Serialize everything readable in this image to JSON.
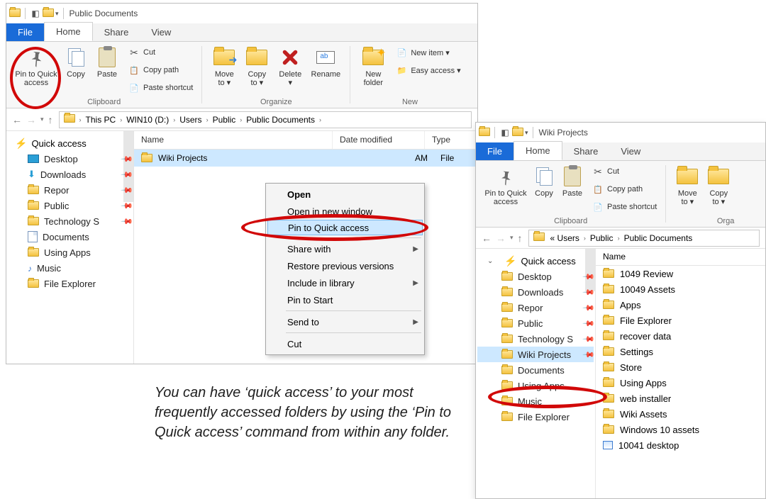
{
  "win1": {
    "title": "Public Documents",
    "tabs": {
      "file": "File",
      "home": "Home",
      "share": "Share",
      "view": "View"
    },
    "ribbon": {
      "pin": "Pin to Quick\naccess",
      "copy": "Copy",
      "paste": "Paste",
      "cut": "Cut",
      "copypath": "Copy path",
      "pasteshortcut": "Paste shortcut",
      "moveto": "Move\nto ▾",
      "copyto": "Copy\nto ▾",
      "delete": "Delete\n▾",
      "rename": "Rename",
      "newfolder": "New\nfolder",
      "newitem": "New item ▾",
      "easyaccess": "Easy access ▾",
      "g_clipboard": "Clipboard",
      "g_organize": "Organize",
      "g_new": "New"
    },
    "breadcrumb": [
      "This PC",
      "WIN10 (D:)",
      "Users",
      "Public",
      "Public Documents"
    ],
    "quickaccess_header": "Quick access",
    "tree": [
      {
        "label": "Desktop",
        "pin": true,
        "ico": "desktop"
      },
      {
        "label": "Downloads",
        "pin": true,
        "ico": "downloads"
      },
      {
        "label": "Repor",
        "pin": true,
        "ico": "folder"
      },
      {
        "label": "Public",
        "pin": true,
        "ico": "folder"
      },
      {
        "label": "Technology S",
        "pin": true,
        "ico": "folder"
      },
      {
        "label": "Documents",
        "pin": false,
        "ico": "doc"
      },
      {
        "label": "Using Apps",
        "pin": false,
        "ico": "folder"
      },
      {
        "label": "Music",
        "pin": false,
        "ico": "music"
      },
      {
        "label": "File Explorer",
        "pin": false,
        "ico": "folder"
      }
    ],
    "columns": {
      "name": "Name",
      "date": "Date modified",
      "type": "Type"
    },
    "row": {
      "name": "Wiki Projects",
      "date": "AM",
      "type": "File"
    },
    "ctx": {
      "open": "Open",
      "opennew": "Open in new window",
      "pin": "Pin to Quick access",
      "sharewith": "Share with",
      "restore": "Restore previous versions",
      "include": "Include in library",
      "pinstart": "Pin to Start",
      "sendto": "Send to",
      "cut": "Cut"
    }
  },
  "win2": {
    "title": "Wiki Projects",
    "tabs": {
      "file": "File",
      "home": "Home",
      "share": "Share",
      "view": "View"
    },
    "ribbon": {
      "pin": "Pin to Quick\naccess",
      "copy": "Copy",
      "paste": "Paste",
      "cut": "Cut",
      "copypath": "Copy path",
      "pasteshortcut": "Paste shortcut",
      "moveto": "Move\nto ▾",
      "copyto": "Copy\nto ▾",
      "g_clipboard": "Clipboard",
      "g_organize": "Orga"
    },
    "breadcrumb_prefix": "«  Users",
    "breadcrumb_tail": [
      "Public",
      "Public Documents"
    ],
    "quickaccess_header": "Quick access",
    "tree": [
      {
        "label": "Desktop",
        "pin": true
      },
      {
        "label": "Downloads",
        "pin": true
      },
      {
        "label": "Repor",
        "pin": true
      },
      {
        "label": "Public",
        "pin": true
      },
      {
        "label": "Technology S",
        "pin": true
      },
      {
        "label": "Wiki Projects",
        "pin": true,
        "sel": true
      },
      {
        "label": "Documents",
        "pin": false
      },
      {
        "label": "Using Apps",
        "pin": false
      },
      {
        "label": "Music",
        "pin": false
      },
      {
        "label": "File Explorer",
        "pin": false
      }
    ],
    "name_col": "Name",
    "files": [
      {
        "label": "1049 Review",
        "t": "f"
      },
      {
        "label": "10049 Assets",
        "t": "f"
      },
      {
        "label": "Apps",
        "t": "f"
      },
      {
        "label": "File Explorer",
        "t": "f"
      },
      {
        "label": "recover data",
        "t": "f"
      },
      {
        "label": "Settings",
        "t": "f"
      },
      {
        "label": "Store",
        "t": "f"
      },
      {
        "label": "Using Apps",
        "t": "f"
      },
      {
        "label": "web installer",
        "t": "f"
      },
      {
        "label": "Wiki Assets",
        "t": "f"
      },
      {
        "label": "Windows 10 assets",
        "t": "f"
      },
      {
        "label": "10041 desktop",
        "t": "img"
      }
    ]
  },
  "caption": "You can have ‘quick access’ to your most frequently accessed folders by using the ‘Pin to Quick access’ command from within any folder."
}
